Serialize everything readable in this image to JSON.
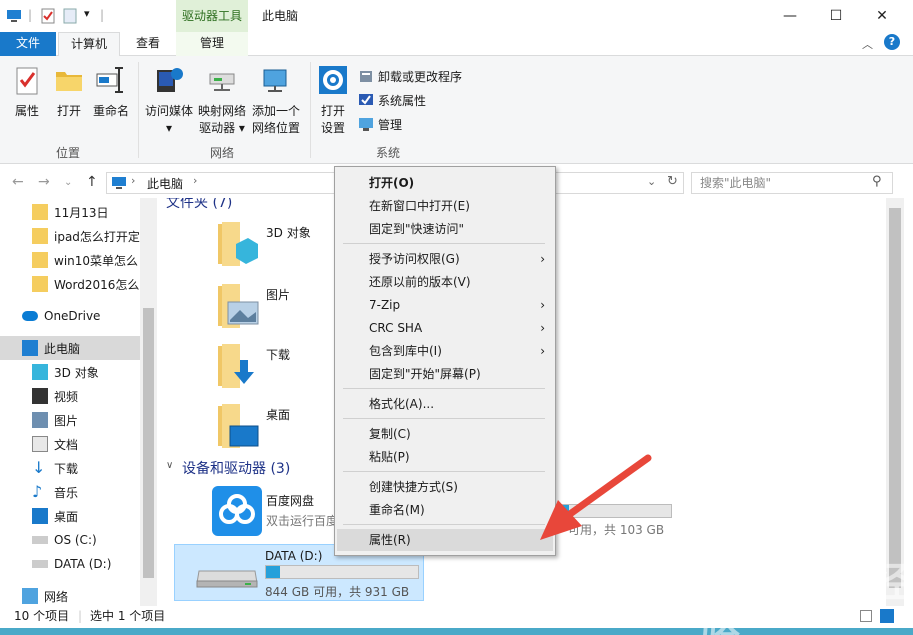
{
  "window": {
    "title": "此电脑",
    "contextual_tab_group": "驱动器工具",
    "minimize": "—",
    "maximize": "☐",
    "close": "✕"
  },
  "tabs": {
    "file": "文件",
    "computer": "计算机",
    "view": "查看",
    "manage": "管理"
  },
  "ribbon": {
    "location": {
      "label": "位置",
      "properties": "属性",
      "open": "打开",
      "rename": "重命名"
    },
    "network": {
      "label": "网络",
      "access_media": [
        "访问媒体",
        "▾"
      ],
      "map_drive": [
        "映射网络",
        "驱动器 ▾"
      ],
      "add_location": [
        "添加一个",
        "网络位置"
      ]
    },
    "system": {
      "label": "系统",
      "open_settings": [
        "打开",
        "设置"
      ],
      "uninstall": "卸载或更改程序",
      "system_properties": "系统属性",
      "manage": "管理"
    }
  },
  "address": {
    "path_item": "此电脑",
    "search_placeholder": "搜索\"此电脑\""
  },
  "nav": {
    "items": [
      {
        "label": "11月13日"
      },
      {
        "label": "ipad怎么打开定"
      },
      {
        "label": "win10菜单怎么"
      },
      {
        "label": "Word2016怎么"
      },
      {
        "label": "OneDrive"
      },
      {
        "label": "此电脑"
      },
      {
        "label": "3D 对象"
      },
      {
        "label": "视频"
      },
      {
        "label": "图片"
      },
      {
        "label": "文档"
      },
      {
        "label": "下载"
      },
      {
        "label": "音乐"
      },
      {
        "label": "桌面"
      },
      {
        "label": "OS (C:)"
      },
      {
        "label": "DATA (D:)"
      },
      {
        "label": "网络"
      }
    ]
  },
  "content": {
    "folders_header": "文件夹 (7)",
    "folders": [
      {
        "name": "3D 对象"
      },
      {
        "name": "图片"
      },
      {
        "name": "下载"
      },
      {
        "name": "桌面"
      }
    ],
    "devices_header": "设备和驱动器 (3)",
    "baidu": {
      "name": "百度网盘",
      "sub": "双击运行百度"
    },
    "c_drive": {
      "free_text": "可用，共 103 GB",
      "used_fraction": 0.12
    },
    "d_drive": {
      "name": "DATA (D:)",
      "free_text": "844 GB 可用，共 931 GB",
      "used_fraction": 0.094
    }
  },
  "status": {
    "count": "10 个项目",
    "selected": "选中 1 个项目"
  },
  "menu": {
    "items": [
      {
        "label": "打开(O)"
      },
      {
        "label": "在新窗口中打开(E)"
      },
      {
        "label": "固定到\"快速访问\""
      },
      {
        "label": "授予访问权限(G)"
      },
      {
        "label": "还原以前的版本(V)"
      },
      {
        "label": "7-Zip"
      },
      {
        "label": "CRC SHA"
      },
      {
        "label": "包含到库中(I)"
      },
      {
        "label": "固定到\"开始\"屏幕(P)"
      },
      {
        "label": "格式化(A)..."
      },
      {
        "label": "复制(C)"
      },
      {
        "label": "粘贴(P)"
      },
      {
        "label": "创建快捷方式(S)"
      },
      {
        "label": "重命名(M)"
      },
      {
        "label": "属性(R)"
      }
    ],
    "submenu_arrow": "›"
  },
  "watermark": {
    "text": "Bai du 经验",
    "url": "jingyan.baidu.com"
  },
  "colors": {
    "accent": "#1979ca",
    "arrow": "#e8473a",
    "drive_fill": "#26a0da",
    "selection": "#cce8ff"
  }
}
